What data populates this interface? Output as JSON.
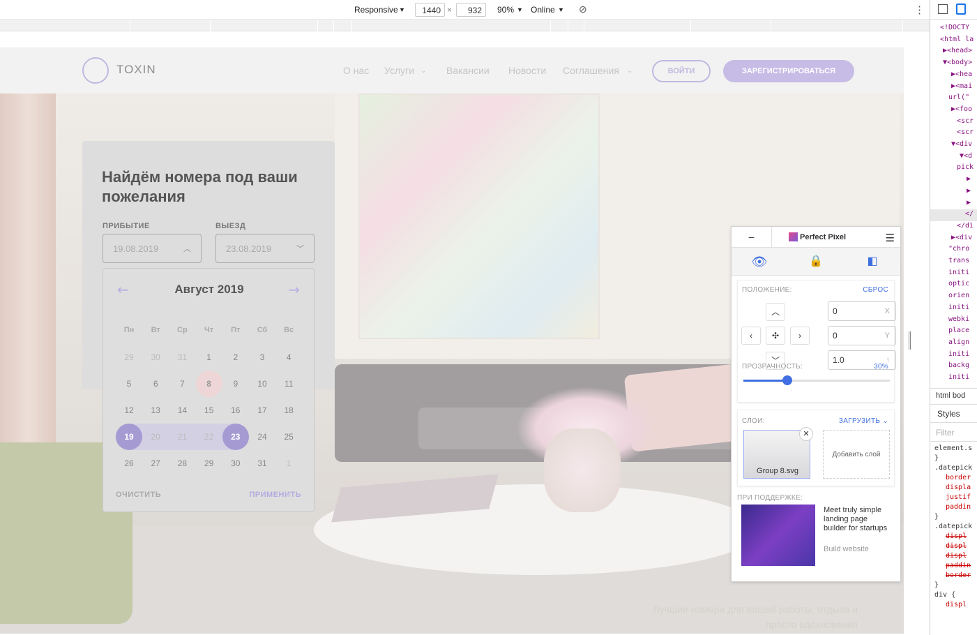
{
  "devtools_toolbar": {
    "device": "Responsive",
    "width": "1440",
    "times": "×",
    "height": "932",
    "zoom": "90%",
    "network": "Online",
    "more": "⋮"
  },
  "header": {
    "logo_text": "TOXIN",
    "nav": [
      "О нас",
      "Услуги",
      "Вакансии",
      "Новости",
      "Соглашения"
    ],
    "login": "ВОЙТИ",
    "register": "ЗАРЕГИСТРИРОВАТЬСЯ"
  },
  "search_card": {
    "title": "Найдём номера под ваши пожелания",
    "arrival_label": "ПРИБЫТИЕ",
    "arrival_value": "19.08.2019",
    "departure_label": "ВЫЕЗД",
    "departure_value": "23.08.2019"
  },
  "calendar": {
    "month": "Август 2019",
    "weekdays": [
      "Пн",
      "Вт",
      "Ср",
      "Чт",
      "Пт",
      "Сб",
      "Вс"
    ],
    "rows": [
      [
        "29",
        "30",
        "31",
        "1",
        "2",
        "3",
        "4"
      ],
      [
        "5",
        "6",
        "7",
        "8",
        "9",
        "10",
        "11"
      ],
      [
        "12",
        "13",
        "14",
        "15",
        "16",
        "17",
        "18"
      ],
      [
        "19",
        "20",
        "21",
        "22",
        "23",
        "24",
        "25"
      ],
      [
        "26",
        "27",
        "28",
        "29",
        "30",
        "31",
        "1"
      ]
    ],
    "clear": "ОЧИСТИТЬ",
    "apply": "ПРИМЕНИТЬ"
  },
  "tagline": "Лучшие номера для вашей работы, отдыха и просто вдохновения",
  "perfect_pixel": {
    "title": "Perfect Pixel",
    "minimize": "–",
    "position_label": "ПОЛОЖЕНИЕ:",
    "reset": "СБРОС",
    "x_value": "0",
    "x_axis": "X",
    "y_value": "0",
    "y_axis": "Y",
    "scale_value": "1.0",
    "opacity_label": "ПРОЗРАЧНОСТЬ:",
    "opacity_value": "30%",
    "opacity_fraction": 0.3,
    "layers_label": "СЛОИ:",
    "upload": "ЗАГРУЗИТЬ",
    "layer_name": "Group 8.svg",
    "add_layer": "Добавить слой",
    "sponsor_label": "ПРИ ПОДДЕРЖКЕ:",
    "ad_text": "Meet truly simple landing page builder for startups",
    "ad_link": "Build website"
  },
  "devtools_panel": {
    "lines": [
      "<!DOCTY",
      "<html la",
      "▶<head>",
      "▼<body>",
      "▶<hea",
      "▶<mai",
      "url(\"",
      "▶<foo",
      "<scr",
      "<scr",
      "▼<div",
      "▼<d",
      "pick",
      "▶",
      "▶",
      "▶",
      "</",
      "</di",
      "▶<div",
      "\"chro",
      "trans",
      "initi",
      "optic",
      "orien",
      "initi",
      "webki",
      "place",
      "align",
      "initi",
      "backg",
      "initi"
    ],
    "crumbs": "html  bod",
    "styles_tab": "Styles",
    "filter": "Filter",
    "css_lines": [
      "element.s",
      "}",
      ".datepick",
      "border",
      "displa",
      "justif",
      "paddin",
      "}",
      ".datepick",
      "displ",
      "displ",
      "displ",
      "paddin",
      "border",
      "}",
      "div {",
      "displ"
    ]
  },
  "colors": {
    "accent": "#bc9cff",
    "pp_blue": "#3f6fe0"
  }
}
